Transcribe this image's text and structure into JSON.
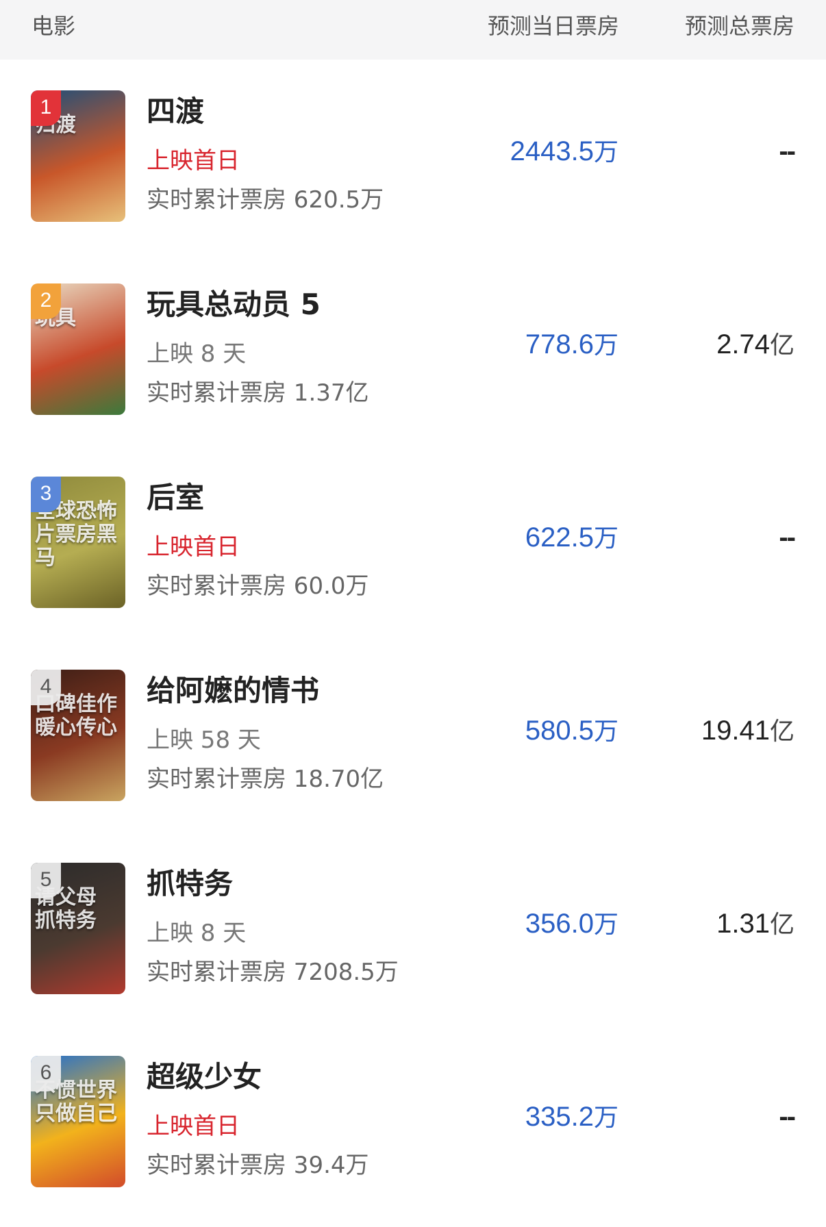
{
  "header": {
    "movie": "电影",
    "day_box_office": "预测当日票房",
    "total_box_office": "预测总票房"
  },
  "movies": [
    {
      "rank": "1",
      "poster_text": "归渡",
      "poster_colors": [
        "#1d4f7a",
        "#c8572a",
        "#e7c07a"
      ],
      "title": "四渡",
      "status": "上映首日",
      "cumulative": "实时累计票房 620.5万",
      "day_value": "2443.5",
      "day_unit": "万",
      "total_value": "--",
      "total_unit": ""
    },
    {
      "rank": "2",
      "poster_text": "玩具",
      "poster_colors": [
        "#e9dcc4",
        "#c74a2b",
        "#3b7a3c"
      ],
      "title": "玩具总动员 5",
      "status": "上映 8 天",
      "cumulative": "实时累计票房 1.37亿",
      "day_value": "778.6",
      "day_unit": "万",
      "total_value": "2.74",
      "total_unit": "亿"
    },
    {
      "rank": "3",
      "poster_text": "全球恐怖片票房黑马",
      "poster_colors": [
        "#8f8a3c",
        "#b5ad52",
        "#6b6226"
      ],
      "title": "后室",
      "status": "上映首日",
      "cumulative": "实时累计票房 60.0万",
      "day_value": "622.5",
      "day_unit": "万",
      "total_value": "--",
      "total_unit": ""
    },
    {
      "rank": "4",
      "poster_text": "口碑佳作 暖心传心",
      "poster_colors": [
        "#3c1e16",
        "#8a3a22",
        "#c9a460"
      ],
      "title": "给阿嬷的情书",
      "status": "上映 58 天",
      "cumulative": "实时累计票房 18.70亿",
      "day_value": "580.5",
      "day_unit": "万",
      "total_value": "19.41",
      "total_unit": "亿"
    },
    {
      "rank": "5",
      "poster_text": "请父母 抓特务",
      "poster_colors": [
        "#2b2b2b",
        "#4b3a30",
        "#b23a2e"
      ],
      "title": "抓特务",
      "status": "上映 8 天",
      "cumulative": "实时累计票房 7208.5万",
      "day_value": "356.0",
      "day_unit": "万",
      "total_value": "1.31",
      "total_unit": "亿"
    },
    {
      "rank": "6",
      "poster_text": "不惯世界 只做自己",
      "poster_colors": [
        "#1f6fd1",
        "#f2b21c",
        "#d24b2a"
      ],
      "title": "超级少女",
      "status": "上映首日",
      "cumulative": "实时累计票房 39.4万",
      "day_value": "335.2",
      "day_unit": "万",
      "total_value": "--",
      "total_unit": ""
    }
  ]
}
